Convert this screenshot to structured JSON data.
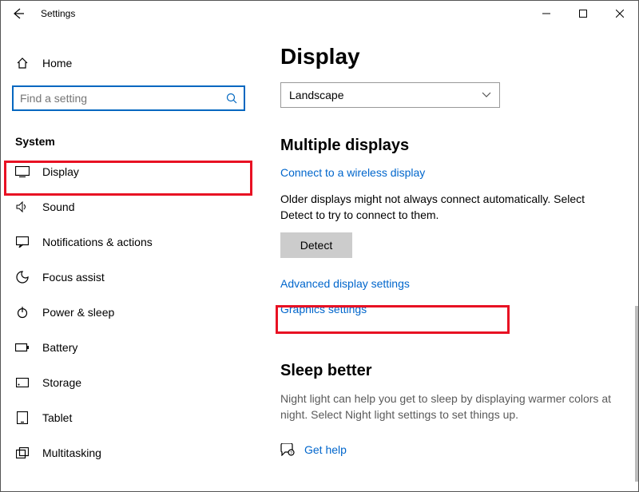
{
  "window": {
    "title": "Settings"
  },
  "sidebar": {
    "home": "Home",
    "search_placeholder": "Find a setting",
    "category": "System",
    "items": [
      {
        "label": "Display"
      },
      {
        "label": "Sound"
      },
      {
        "label": "Notifications & actions"
      },
      {
        "label": "Focus assist"
      },
      {
        "label": "Power & sleep"
      },
      {
        "label": "Battery"
      },
      {
        "label": "Storage"
      },
      {
        "label": "Tablet"
      },
      {
        "label": "Multitasking"
      }
    ]
  },
  "main": {
    "heading": "Display",
    "orientation": "Landscape",
    "multi_heading": "Multiple displays",
    "connect_link": "Connect to a wireless display",
    "older_text": "Older displays might not always connect automatically. Select Detect to try to connect to them.",
    "detect": "Detect",
    "advanced_link": "Advanced display settings",
    "graphics_link": "Graphics settings",
    "sleep_heading": "Sleep better",
    "sleep_desc": "Night light can help you get to sleep by displaying warmer colors at night. Select Night light settings to set things up.",
    "get_help": "Get help"
  }
}
